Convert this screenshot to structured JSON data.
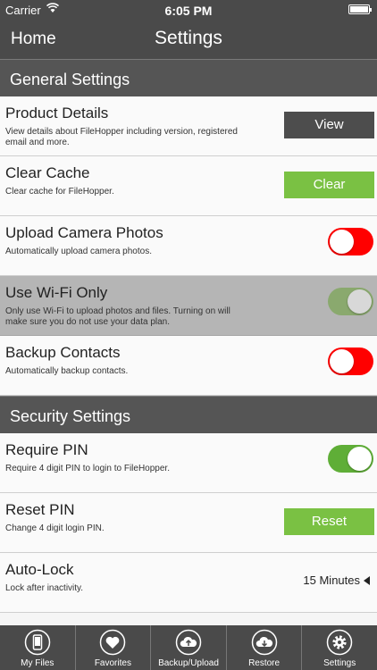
{
  "status": {
    "carrier": "Carrier",
    "time": "6:05 PM"
  },
  "nav": {
    "back": "Home",
    "title": "Settings"
  },
  "general": {
    "header": "General Settings",
    "product": {
      "title": "Product Details",
      "desc": "View details about FileHopper including version, registered email and more.",
      "button": "View"
    },
    "cache": {
      "title": "Clear Cache",
      "desc": "Clear cache for FileHopper.",
      "button": "Clear"
    },
    "camera": {
      "title": "Upload Camera Photos",
      "desc": "Automatically upload camera photos.",
      "state": "off"
    },
    "wifi": {
      "title": "Use Wi-Fi Only",
      "desc": "Only use Wi-Fi to upload photos and files. Turning on will make sure you do not use your data plan.",
      "state": "on"
    },
    "contacts": {
      "title": "Backup Contacts",
      "desc": "Automatically backup contacts.",
      "state": "off"
    }
  },
  "security": {
    "header": "Security Settings",
    "pin": {
      "title": "Require PIN",
      "desc": "Require 4 digit PIN to login to FileHopper.",
      "state": "on"
    },
    "reset": {
      "title": "Reset PIN",
      "desc": "Change 4 digit login PIN.",
      "button": "Reset"
    },
    "autolock": {
      "title": "Auto-Lock",
      "desc": "Lock after inactivity.",
      "value": "15 Minutes"
    }
  },
  "tabs": [
    {
      "label": "My Files",
      "icon": "phone-icon"
    },
    {
      "label": "Favorites",
      "icon": "heart-icon"
    },
    {
      "label": "Backup/Upload",
      "icon": "cloud-upload-icon"
    },
    {
      "label": "Restore",
      "icon": "cloud-download-icon"
    },
    {
      "label": "Settings",
      "icon": "gear-icon"
    }
  ],
  "colors": {
    "green": "#7ac143",
    "red": "#ff0000",
    "dark": "#4a4a4a"
  }
}
